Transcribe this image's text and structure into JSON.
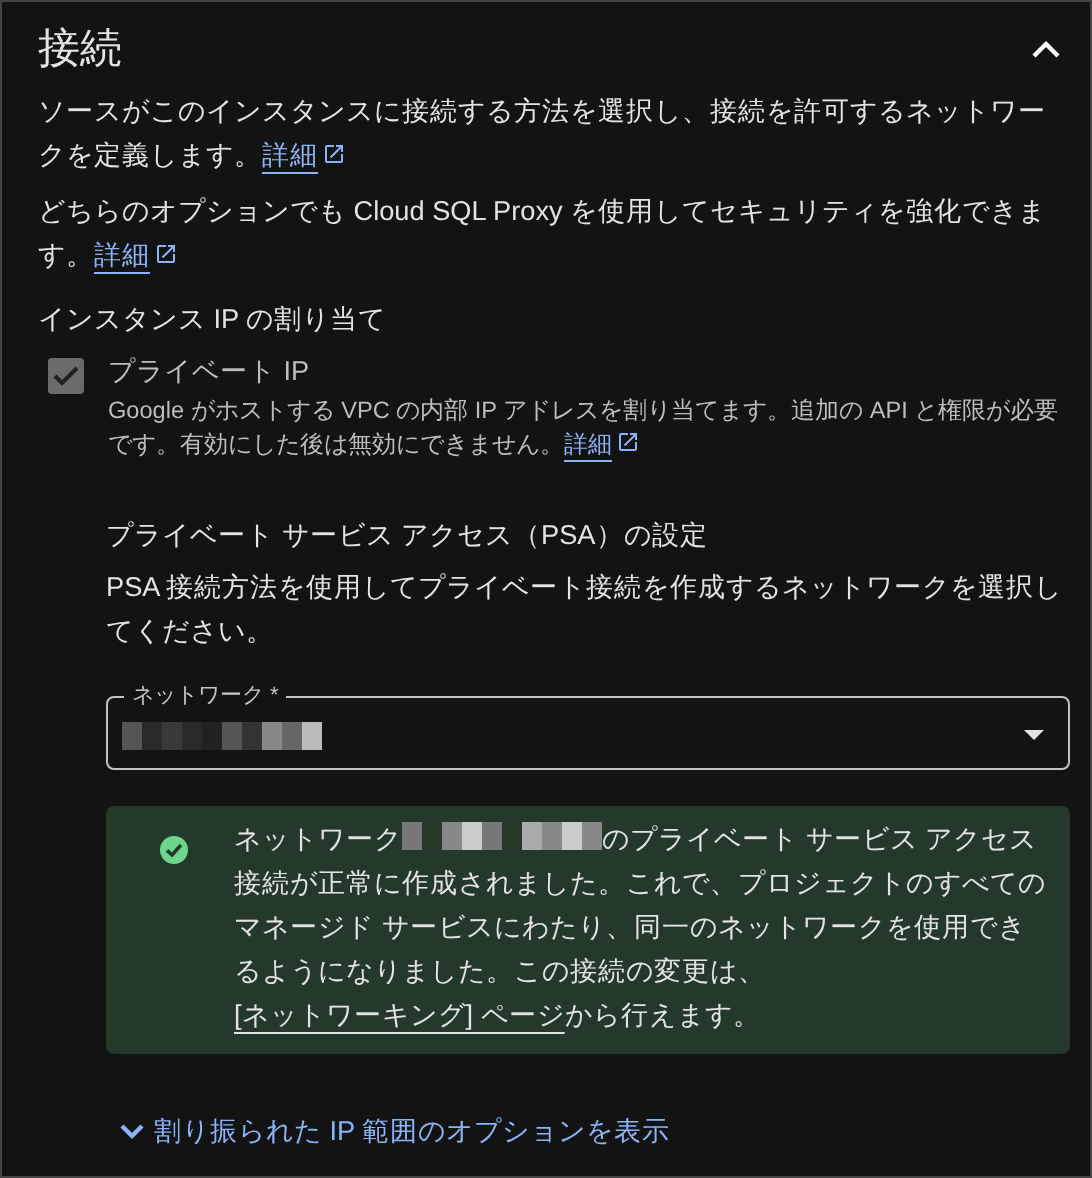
{
  "section": {
    "title": "接続",
    "expanded": true
  },
  "intro": [
    {
      "text": "ソースがこのインスタンスに接続する方法を選択し、接続を許可するネットワークを定義します。",
      "link": "詳細"
    },
    {
      "text": "どちらのオプションでも Cloud SQL Proxy を使用してセキュリティを強化できます。",
      "link": "詳細"
    }
  ],
  "ip_assignment": {
    "heading": "インスタンス IP の割り当て",
    "option": {
      "label": "プライベート IP",
      "checked": true,
      "disabled": true,
      "description": "Google がホストする VPC の内部 IP アドレスを割り当てます。追加の API と権限が必要です。有効にした後は無効にできません。",
      "link": "詳細"
    }
  },
  "psa": {
    "heading": "プライベート サービス アクセス（PSA）の設定",
    "description": "PSA 接続方法を使用してプライベート接続を作成するネットワークを選択してください。",
    "network_field": {
      "label": "ネットワーク *"
    },
    "alert": {
      "before": "ネットワーク",
      "after": "のプライベート サービス アクセス接続が正常に作成されました。これで、プロジェクトのすべてのマネージド サービスにわたり、同一のネットワークを使用できるようになりました。この接続の変更は、",
      "link": "[ネットワーキング] ページ",
      "end": "から行えます。"
    },
    "toggle": {
      "label": "割り振られた IP 範囲のオプションを表示",
      "expanded": false
    }
  }
}
